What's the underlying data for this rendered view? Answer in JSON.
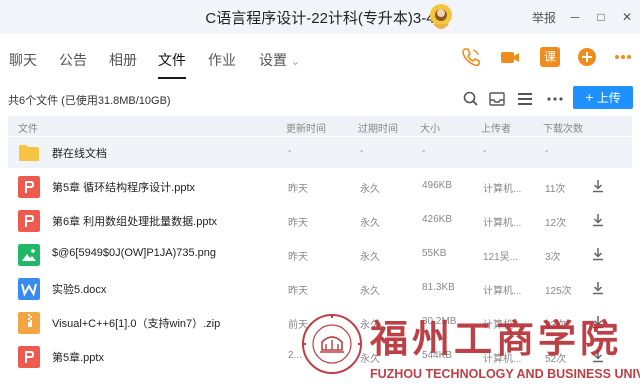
{
  "window": {
    "title": "C语言程序设计-22计科(专升本)3-4",
    "report_label": "举报",
    "minimize": "─",
    "maximize": "□",
    "close": "✕"
  },
  "nav": {
    "tabs": [
      "聊天",
      "公告",
      "相册",
      "文件",
      "作业",
      "设置"
    ],
    "active_tab": "文件",
    "settings_chevron": "⌄",
    "course_label": "课"
  },
  "files": {
    "storage": "共6个文件 (已使用31.8MB/10GB)",
    "upload_label": "上传",
    "columns": {
      "name": "文件",
      "updated": "更新时间",
      "expiry": "过期时间",
      "size": "大小",
      "uploader": "上传者",
      "downloads": "下载次数"
    },
    "rows": [
      {
        "name": "群在线文档",
        "type": "folder",
        "updated": "-",
        "expiry": "-",
        "size": "-",
        "uploader": "-",
        "downloads": "-"
      },
      {
        "name": "第5章 循环结构程序设计.pptx",
        "type": "ppt",
        "updated": "昨天",
        "expiry": "永久",
        "size": "496KB",
        "uploader": "计算机...",
        "downloads": "11次"
      },
      {
        "name": "第6章 利用数组处理批量数据.pptx",
        "type": "ppt",
        "updated": "昨天",
        "expiry": "永久",
        "size": "426KB",
        "uploader": "计算机...",
        "downloads": "12次"
      },
      {
        "name": "$@6[5949$0J(OW]P1JA)735.png",
        "type": "image",
        "updated": "昨天",
        "expiry": "永久",
        "size": "55KB",
        "uploader": "121吴...",
        "downloads": "3次"
      },
      {
        "name": "实验5.docx",
        "type": "word",
        "updated": "昨天",
        "expiry": "永久",
        "size": "81.3KB",
        "uploader": "计算机...",
        "downloads": "125次"
      },
      {
        "name": "Visual+C++6[1].0（支持win7）.zip",
        "type": "zip",
        "updated": "前天",
        "expiry": "永久",
        "size": "30.2MB",
        "uploader": "计算机...",
        "downloads": "23次"
      },
      {
        "name": "第5章.pptx",
        "type": "ppt",
        "updated": "2...",
        "expiry": "永久",
        "size": "544KB",
        "uploader": "计算机...",
        "downloads": "52次"
      }
    ]
  },
  "watermark": {
    "cn": "福州工商学院",
    "en": "FUZHOU TECHNOLOGY AND BUSINESS UNIVERSITY",
    "seal_text": "FUZHOU TECHNOLOGY AND BUSINESS UNIVERSITY",
    "color": "#b3262c"
  },
  "icons": {
    "phone": "phone-icon",
    "video": "video-call-icon",
    "add": "plus-icon",
    "more": "more-icon",
    "search": "search-icon",
    "inbox": "inbox-icon",
    "grid": "grid-view-icon",
    "download": "download-icon"
  },
  "colors": {
    "accent": "#1e90ff",
    "ppt": "#ef5a4f",
    "folder": "#f7c343",
    "image": "#20b866",
    "word": "#3b8af0",
    "zip": "#f2a541",
    "course": "#f08c1c"
  }
}
